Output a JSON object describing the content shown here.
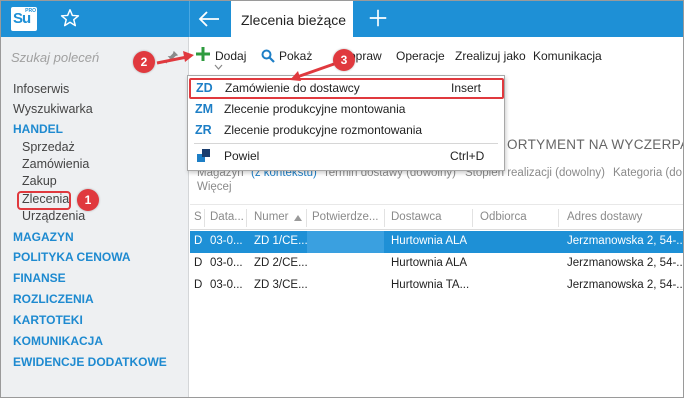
{
  "app": {
    "logo_text": "Su",
    "logo_sup": "PRO",
    "active_tab": "Zlecenia bieżące"
  },
  "sidebar": {
    "search_placeholder": "Szukaj poleceń",
    "items": [
      {
        "label": "Infoserwis",
        "type": "item"
      },
      {
        "label": "Wyszukiwarka",
        "type": "item"
      },
      {
        "label": "HANDEL",
        "type": "category"
      },
      {
        "label": "Sprzedaż",
        "type": "sub"
      },
      {
        "label": "Zamówienia",
        "type": "sub"
      },
      {
        "label": "Zakup",
        "type": "sub"
      },
      {
        "label": "Zlecenia",
        "type": "sub"
      },
      {
        "label": "Urządzenia",
        "type": "sub"
      },
      {
        "label": "MAGAZYN",
        "type": "category"
      },
      {
        "label": "POLITYKA CENOWA",
        "type": "category"
      },
      {
        "label": "FINANSE",
        "type": "category"
      },
      {
        "label": "ROZLICZENIA",
        "type": "category"
      },
      {
        "label": "KARTOTEKI",
        "type": "category"
      },
      {
        "label": "KOMUNIKACJA",
        "type": "category"
      },
      {
        "label": "EWIDENCJE DODATKOWE",
        "type": "category"
      }
    ]
  },
  "toolbar": {
    "add_label": "Dodaj",
    "show_label": "Pokaż",
    "edit_label": "Popraw",
    "operations_label": "Operacje",
    "execute_label": "Zrealizuj jako",
    "communication_label": "Komunikacja"
  },
  "menu": {
    "items": [
      {
        "code": "ZD",
        "label": "Zamówienie do dostawcy",
        "shortcut": "Insert"
      },
      {
        "code": "ZM",
        "label": "Zlecenie produkcyjne montowania",
        "shortcut": ""
      },
      {
        "code": "ZR",
        "label": "Zlecenie produkcyjne rozmontowania",
        "shortcut": ""
      }
    ],
    "duplicate": {
      "label": "Powiel",
      "shortcut": "Ctrl+D"
    }
  },
  "content": {
    "section_title": "ORTYMENT NA WYCZERPANIU",
    "filters": {
      "magazyn": "Magazyn",
      "magazyn_link": "(z kontekstu)",
      "termin": "Termin dostawy (dowolny)",
      "stopien": "Stopień realizacji (dowolny)",
      "kategoria": "Kategoria (do",
      "wiecej": "Więcej"
    }
  },
  "table": {
    "columns": [
      "S",
      "Data...",
      "Numer",
      "Potwierdze...",
      "Dostawca",
      "Odbiorca",
      "Adres dostawy"
    ],
    "rows": [
      {
        "s": "D",
        "data": "03-0...",
        "numer": "ZD 1/CE...",
        "potw": "",
        "dostawca": "Hurtownia ALA",
        "odbiorca": "",
        "adres": "Jerzmanowska 2, 54-..."
      },
      {
        "s": "D",
        "data": "03-0...",
        "numer": "ZD 2/CE...",
        "potw": "",
        "dostawca": "Hurtownia ALA",
        "odbiorca": "",
        "adres": "Jerzmanowska 2, 54-..."
      },
      {
        "s": "D",
        "data": "03-0...",
        "numer": "ZD 3/CE...",
        "potw": "",
        "dostawca": "Hurtownia TA...",
        "odbiorca": "",
        "adres": "Jerzmanowska 2, 54-..."
      }
    ]
  },
  "annotations": {
    "badge1": "1",
    "badge2": "2",
    "badge3": "3"
  },
  "colors": {
    "accent": "#1e90d6",
    "highlight": "#e0393e",
    "category": "#1e8ad0"
  }
}
